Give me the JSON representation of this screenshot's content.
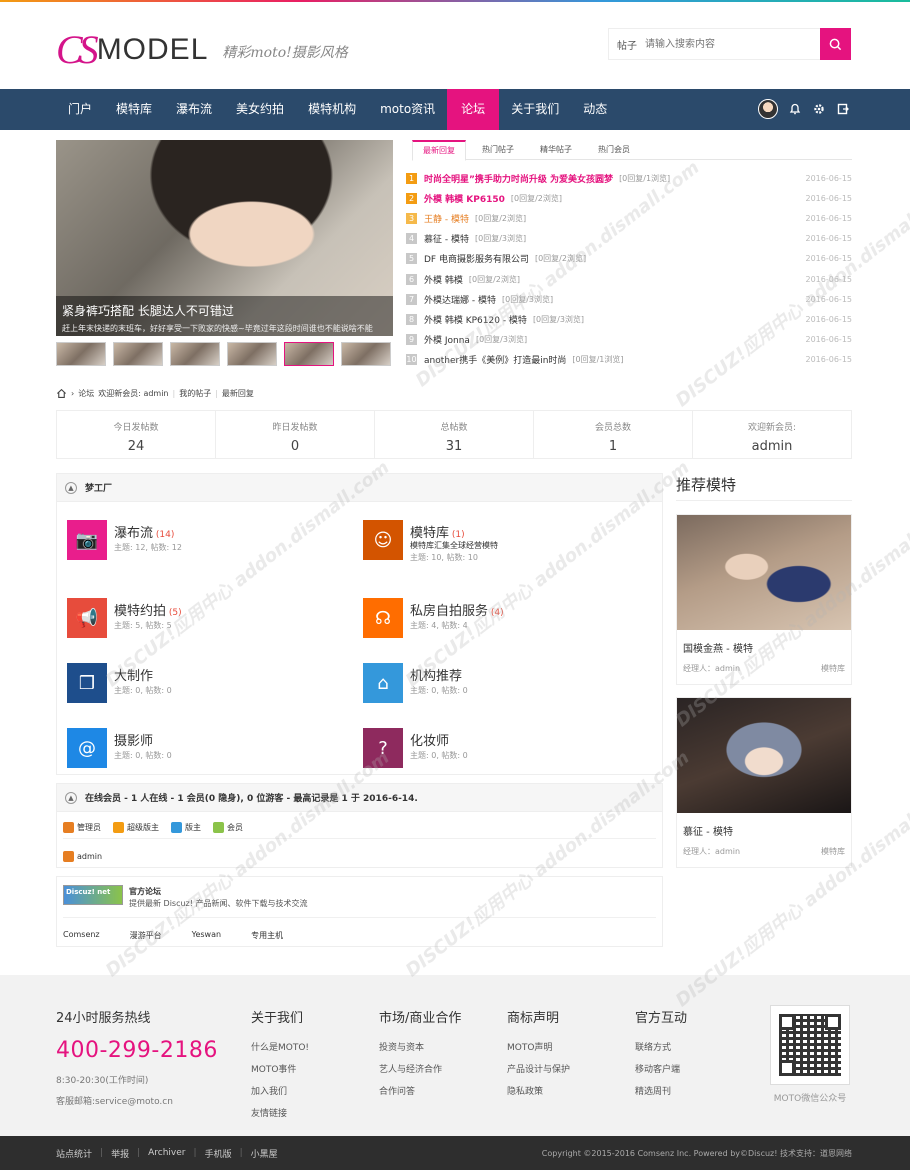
{
  "header": {
    "logo_mark": "CS",
    "logo_text": "MODEL",
    "slogan": "精彩moto!摄影风格",
    "search_type": "帖子",
    "search_placeholder": "请输入搜索内容"
  },
  "nav": {
    "items": [
      "门户",
      "模特库",
      "瀑布流",
      "美女约拍",
      "模特机构",
      "moto资讯",
      "论坛",
      "关于我们",
      "动态"
    ],
    "active_index": 6
  },
  "slider": {
    "title": "紧身裤巧搭配 长腿达人不可错过",
    "desc": "赶上年末快递的末班车，好好享受一下败家的快感~毕竟过年这段时间谁也不能说啥不能"
  },
  "tabs": [
    "最新回复",
    "热门帖子",
    "精华帖子",
    "热门会员"
  ],
  "posts": [
    {
      "num": "1",
      "title": "时尚全明星”携手助力时尚升级 为爱美女孩圆梦",
      "meta": "[0回复/1浏览]",
      "date": "2016-06-15",
      "style": "hot"
    },
    {
      "num": "2",
      "title": "外模 韩模 KP6150",
      "meta": "[0回复/2浏览]",
      "date": "2016-06-15",
      "style": "hot"
    },
    {
      "num": "3",
      "title": "王静 - 模特",
      "meta": "[0回复/2浏览]",
      "date": "2016-06-15",
      "style": "warm"
    },
    {
      "num": "4",
      "title": "慕征 - 模特",
      "meta": "[0回复/3浏览]",
      "date": "2016-06-15",
      "style": ""
    },
    {
      "num": "5",
      "title": "DF 电商摄影服务有限公司",
      "meta": "[0回复/2浏览]",
      "date": "2016-06-15",
      "style": ""
    },
    {
      "num": "6",
      "title": "外模 韩模",
      "meta": "[0回复/2浏览]",
      "date": "2016-06-15",
      "style": ""
    },
    {
      "num": "7",
      "title": "外模达瑞娜 - 模特",
      "meta": "[0回复/3浏览]",
      "date": "2016-06-15",
      "style": ""
    },
    {
      "num": "8",
      "title": "外模 韩模 KP6120 - 模特",
      "meta": "[0回复/3浏览]",
      "date": "2016-06-15",
      "style": ""
    },
    {
      "num": "9",
      "title": "外模 Jonna",
      "meta": "[0回复/3浏览]",
      "date": "2016-06-15",
      "style": ""
    },
    {
      "num": "10",
      "title": "another携手《美例》打造最in时尚",
      "meta": "[0回复/1浏览]",
      "date": "2016-06-15",
      "style": ""
    }
  ],
  "breadcrumb": {
    "section": "论坛",
    "welcome": "欢迎新会员: admin",
    "my_posts": "我的帖子",
    "latest": "最新回复"
  },
  "stats": [
    {
      "label": "今日发帖数",
      "value": "24"
    },
    {
      "label": "昨日发帖数",
      "value": "0"
    },
    {
      "label": "总帖数",
      "value": "31"
    },
    {
      "label": "会员总数",
      "value": "1"
    },
    {
      "label": "欢迎新会员:",
      "value": "admin"
    }
  ],
  "forum_group": {
    "title": "梦工厂",
    "forums": [
      {
        "name": "瀑布流",
        "count": "(14)",
        "sub": "主题: 12, 帖数: 12",
        "desc": "",
        "color": "#e91e8c",
        "icon": "camera-icon",
        "glyph": "📷"
      },
      {
        "name": "模特库",
        "count": "(1)",
        "sub": "主题: 10, 帖数: 10",
        "desc": "模特库汇集全球经营模特",
        "color": "#d35400",
        "icon": "smile-icon",
        "glyph": "☺"
      },
      {
        "name": "模特约拍",
        "count": "(5)",
        "sub": "主题: 5, 帖数: 5",
        "desc": "",
        "color": "#e74c3c",
        "icon": "megaphone-icon",
        "glyph": "📢"
      },
      {
        "name": "私房自拍服务",
        "count": "(4)",
        "sub": "主题: 4, 帖数: 4",
        "desc": "",
        "color": "#ff6d00",
        "icon": "headset-icon",
        "glyph": "☊"
      },
      {
        "name": "大制作",
        "count": "",
        "sub": "主题: 0, 帖数: 0",
        "desc": "",
        "color": "#1e4e8c",
        "icon": "box-icon",
        "glyph": "❒"
      },
      {
        "name": "机构推荐",
        "count": "",
        "sub": "主题: 0, 帖数: 0",
        "desc": "",
        "color": "#3498db",
        "icon": "home-icon",
        "glyph": "⌂"
      },
      {
        "name": "摄影师",
        "count": "",
        "sub": "主题: 0, 帖数: 0",
        "desc": "",
        "color": "#1e88e5",
        "icon": "mail-icon",
        "glyph": "@"
      },
      {
        "name": "化妆师",
        "count": "",
        "sub": "主题: 0, 帖数: 0",
        "desc": "",
        "color": "#8e2a5e",
        "icon": "question-icon",
        "glyph": "?"
      }
    ]
  },
  "online": {
    "title": "在线会员 - 1 人在线 - 1 会员(0 隐身), 0 位游客 - 最高记录是 1 于 2016-6-14.",
    "legend": [
      {
        "label": "管理员",
        "color": "#e67e22"
      },
      {
        "label": "超级版主",
        "color": "#f39c12"
      },
      {
        "label": "版主",
        "color": "#3498db"
      },
      {
        "label": "会员",
        "color": "#8bc34a"
      }
    ],
    "user": "admin"
  },
  "links": {
    "badge": "Discuz! net",
    "title": "官方论坛",
    "desc": "提供最新 Discuz! 产品新闻、软件下载与技术交流",
    "items": [
      "Comsenz",
      "漫游平台",
      "Yeswan",
      "专用主机"
    ]
  },
  "sidebar": {
    "title": "推荐模特",
    "models": [
      {
        "name": "国模金燕 - 模特",
        "agent": "经理人：admin",
        "tag": "模特库"
      },
      {
        "name": "慕征 - 模特",
        "agent": "经理人：admin",
        "tag": "模特库"
      }
    ]
  },
  "footer": {
    "hotline_title": "24小时服务热线",
    "hotline": "400-299-2186",
    "hours": "8:30-20:30(工作时间)",
    "email": "客服邮箱:service@moto.cn",
    "columns": [
      {
        "title": "关于我们",
        "links": [
          "什么是MOTO!",
          "MOTO事件",
          "加入我们",
          "友情链接"
        ]
      },
      {
        "title": "市场/商业合作",
        "links": [
          "投资与资本",
          "艺人与经济合作",
          "合作问答"
        ]
      },
      {
        "title": "商标声明",
        "links": [
          "MOTO声明",
          "产品设计与保护",
          "隐私政策"
        ]
      },
      {
        "title": "官方互动",
        "links": [
          "联络方式",
          "移动客户端",
          "精选周刊"
        ]
      }
    ],
    "qr_caption": "MOTO微信公众号"
  },
  "bottom": {
    "links": [
      "站点统计",
      "举报",
      "Archiver",
      "手机版",
      "小黑屋"
    ],
    "copyright": "Copyright  ©2015-2016  Comsenz Inc.  Powered by©Discuz!  技术支持：道恩网络"
  },
  "watermark": "DISCUZ!应用中心 addon.dismall.com"
}
